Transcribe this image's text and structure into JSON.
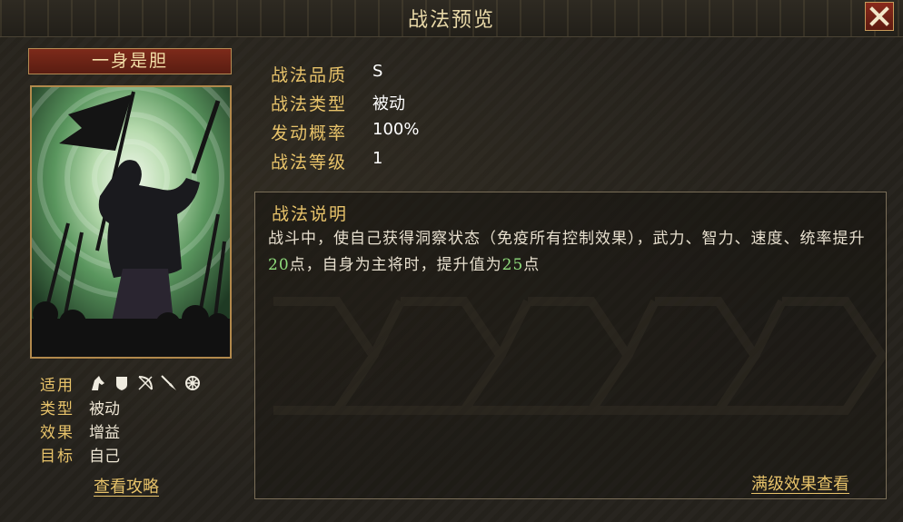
{
  "window": {
    "title": "战法预览",
    "close_icon": "close-icon"
  },
  "skill": {
    "name": "一身是胆",
    "card_image": "silhouette of general raising sword with banner and troops"
  },
  "properties": {
    "applies_label": "适用",
    "applies_icons": [
      "cavalry-icon",
      "shield-icon",
      "bow-icon",
      "spear-icon",
      "chariot-icon"
    ],
    "type_label": "类型",
    "type_value": "被动",
    "effect_label": "效果",
    "effect_value": "增益",
    "target_label": "目标",
    "target_value": "自己"
  },
  "guide_link": "查看攻略",
  "info": [
    {
      "label": "战法品质",
      "value": "S"
    },
    {
      "label": "战法类型",
      "value": "被动"
    },
    {
      "label": "发动概率",
      "value": "100%"
    },
    {
      "label": "战法等级",
      "value": "1"
    }
  ],
  "description": {
    "title": "战法说明",
    "part1": "战斗中，使自己获得洞察状态（免疫所有控制效果），武力、智力、速度、统率提升",
    "value1": "20",
    "part2": "点，自身为主将时，提升值为",
    "value2": "25",
    "part3": "点",
    "highlight_color": "#8fdc7c"
  },
  "full_level_link": "满级效果查看",
  "colors": {
    "accent_gold": "#e8c36a",
    "plate_red": "#7d2a1a",
    "card_border": "#b2894c"
  }
}
